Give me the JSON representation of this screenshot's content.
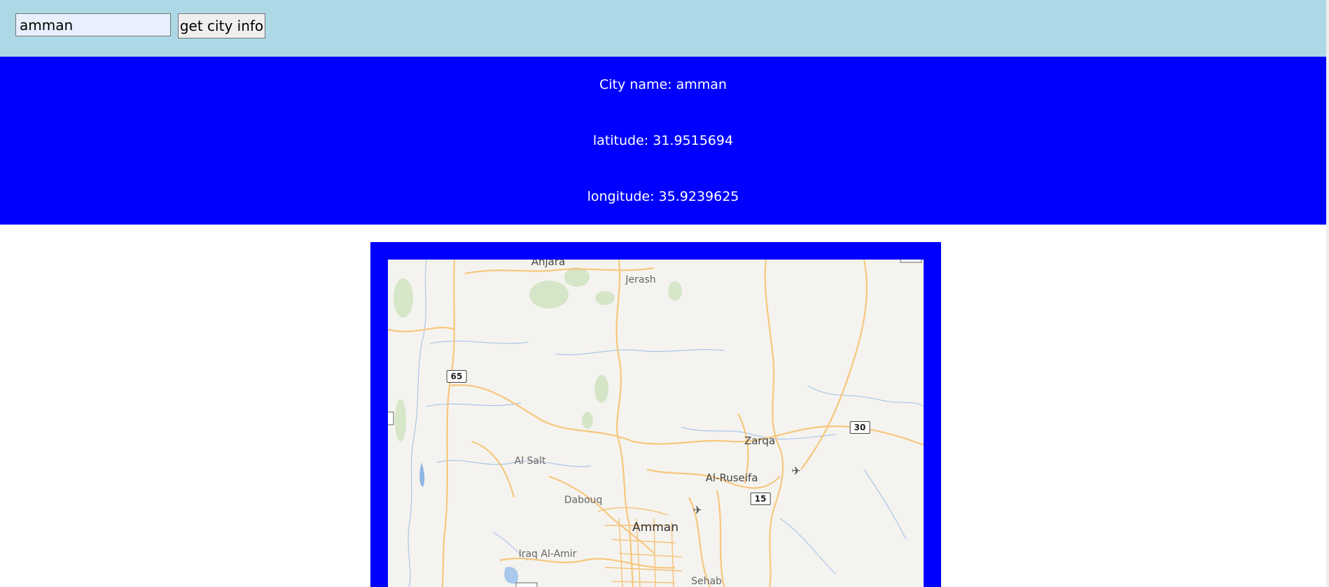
{
  "search": {
    "value": "amman",
    "button_label": "get city info"
  },
  "info": {
    "city_line": "City name: amman",
    "latitude_line": "latitude: 31.9515694",
    "longitude_line": "longitude: 35.9239625"
  },
  "map": {
    "labels": {
      "anjara": "Anjara",
      "jerash": "Jerash",
      "zarqa": "Zarqa",
      "al_salt": "Al Salt",
      "al_ruseifa": "Al-Ruseifa",
      "dabouq": "Dabouq",
      "amman": "Amman",
      "iraq_al_amir": "Iraq Al-Amir",
      "sehab": "Sehab"
    },
    "shields": {
      "r65": "65",
      "r30": "30",
      "r15": "15"
    },
    "icons": [
      "airport-icon",
      "airport-icon"
    ],
    "colors": {
      "land": "#f5f3ef",
      "roads": "#f6c77d",
      "water": "#a8c8ec",
      "parks": "#cfe3c0"
    }
  }
}
